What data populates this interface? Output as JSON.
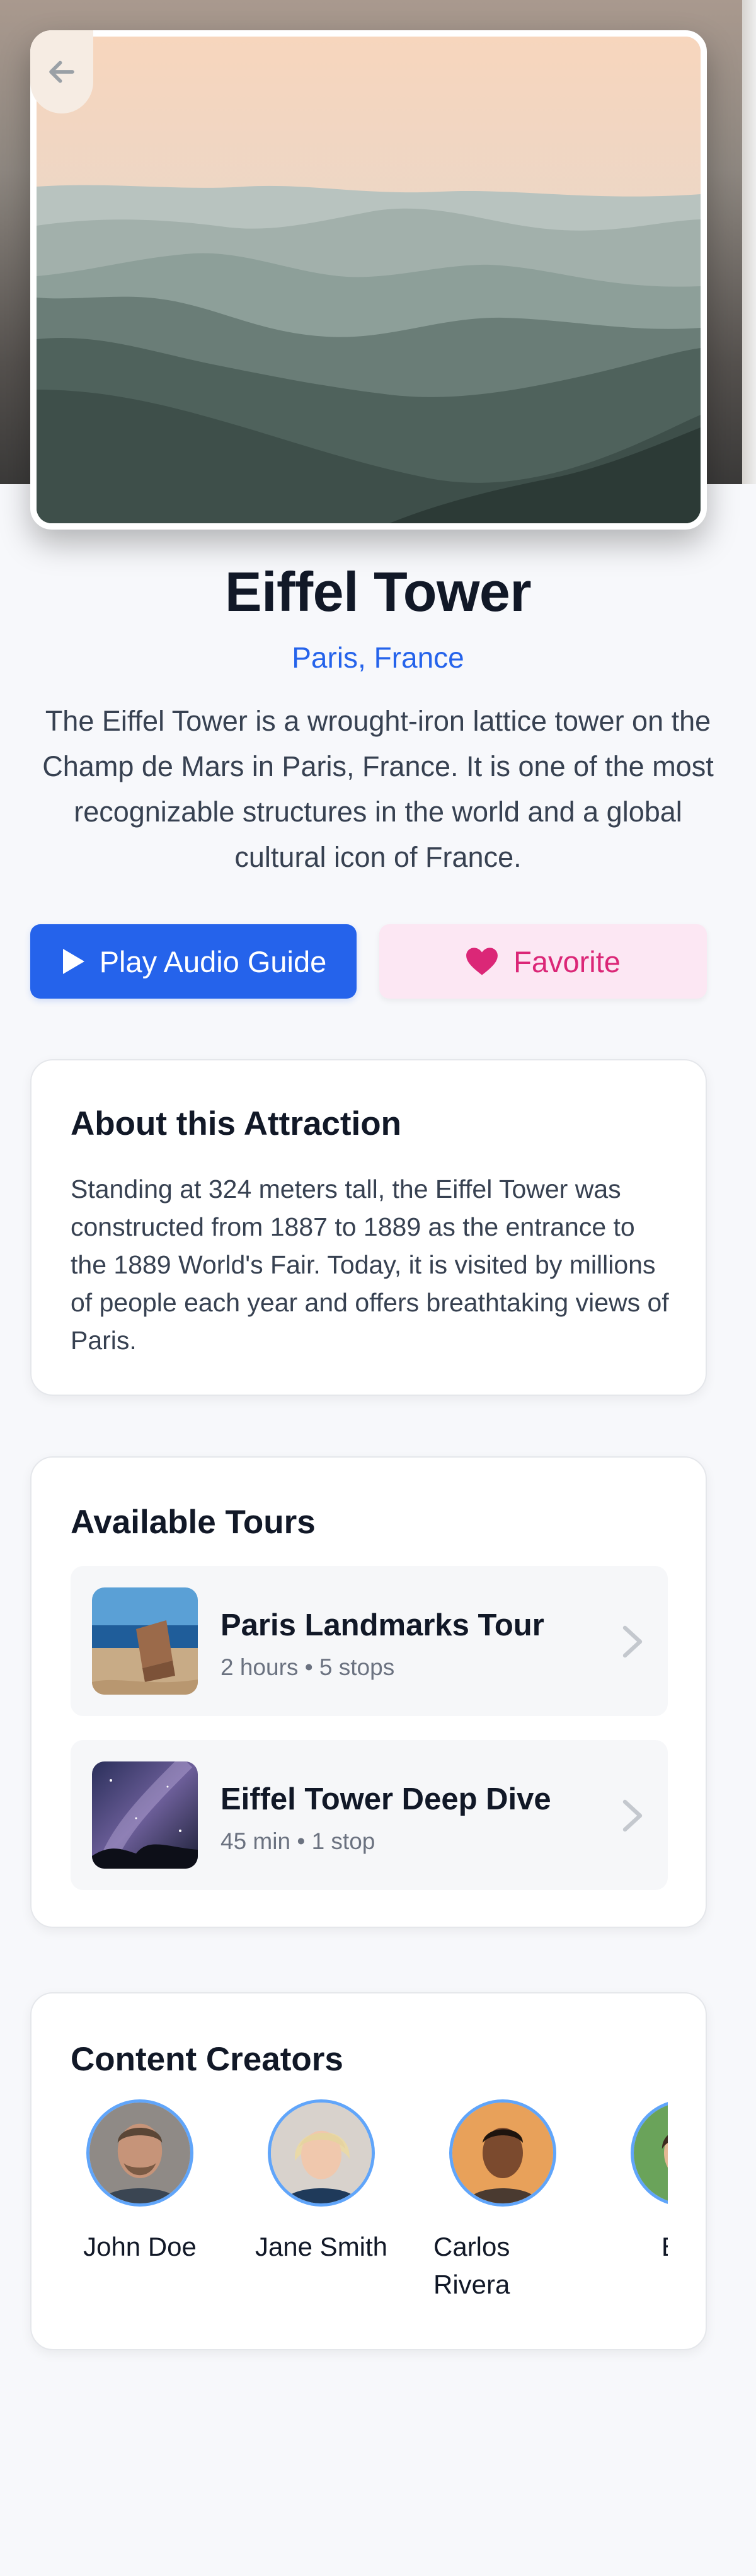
{
  "attraction": {
    "title": "Eiffel Tower",
    "location": "Paris, France",
    "description": "The Eiffel Tower is a wrought-iron lattice tower on the Champ de Mars in Paris, France. It is one of the most recognizable structures in the world and a global cultural icon of France."
  },
  "actions": {
    "play_label": "Play Audio Guide",
    "favorite_label": "Favorite"
  },
  "about": {
    "heading": "About this Attraction",
    "body": "Standing at 324 meters tall, the Eiffel Tower was constructed from 1887 to 1889 as the entrance to the 1889 World's Fair. Today, it is visited by millions of people each year and offers breathtaking views of Paris."
  },
  "tours": {
    "heading": "Available Tours",
    "items": [
      {
        "title": "Paris Landmarks Tour",
        "meta": "2 hours • 5 stops"
      },
      {
        "title": "Eiffel Tower Deep Dive",
        "meta": "45 min • 1 stop"
      }
    ]
  },
  "creators": {
    "heading": "Content Creators",
    "items": [
      {
        "name": "John Doe"
      },
      {
        "name": "Jane Smith"
      },
      {
        "name": "Carlos Rivera"
      },
      {
        "name": "Emi"
      }
    ]
  },
  "icons": {
    "back": "arrow-left-icon",
    "play": "play-icon",
    "favorite": "heart-icon",
    "chevron": "chevron-right-icon"
  },
  "colors": {
    "primary": "#2563eb",
    "favorite_text": "#db2777",
    "favorite_bg": "#fce7f3",
    "avatar_ring": "#60a5fa"
  }
}
